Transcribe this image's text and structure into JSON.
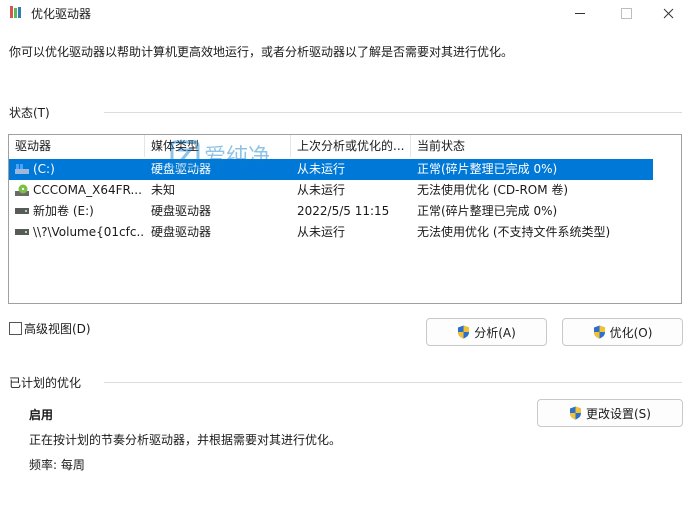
{
  "window": {
    "title": "优化驱动器"
  },
  "description": "你可以优化驱动器以帮助计算机更高效地运行，或者分析驱动器以了解是否需要对其进行优化。",
  "status_group": {
    "label": "状态(T)"
  },
  "table": {
    "columns": [
      "驱动器",
      "媒体类型",
      "上次分析或优化的...",
      "当前状态"
    ],
    "rows": [
      {
        "drive": "(C:)",
        "media": "硬盘驱动器",
        "last": "从未运行",
        "status": "正常(碎片整理已完成 0%)",
        "icon": "windows-drive-icon",
        "selected": true
      },
      {
        "drive": "CCCOMA_X64FR...",
        "media": "未知",
        "last": "从未运行",
        "status": "无法使用优化 (CD-ROM 卷)",
        "icon": "cd-drive-icon",
        "selected": false
      },
      {
        "drive": "新加卷 (E:)",
        "media": "硬盘驱动器",
        "last": "2022/5/5 11:15",
        "status": "正常(碎片整理已完成 0%)",
        "icon": "hard-drive-icon",
        "selected": false
      },
      {
        "drive": "\\\\?\\Volume{01cfc...",
        "media": "硬盘驱动器",
        "last": "从未运行",
        "status": "无法使用优化 (不支持文件系统类型)",
        "icon": "hard-drive-icon",
        "selected": false
      }
    ]
  },
  "advanced_view_label": "高级视图(D)",
  "buttons": {
    "analyze": "分析(A)",
    "optimize": "优化(O)",
    "change_settings": "更改设置(S)"
  },
  "scheduled": {
    "group_label": "已计划的优化",
    "state": "启用",
    "description": "正在按计划的节奏分析驱动器，并根据需要对其进行优化。",
    "frequency": "频率: 每周"
  },
  "watermark": {
    "text": "爱纯净",
    "subtext": "aichunjing.com"
  },
  "colors": {
    "selection": "#0078d7",
    "shield_blue": "#2b6fcf",
    "shield_yellow": "#f2c230"
  }
}
